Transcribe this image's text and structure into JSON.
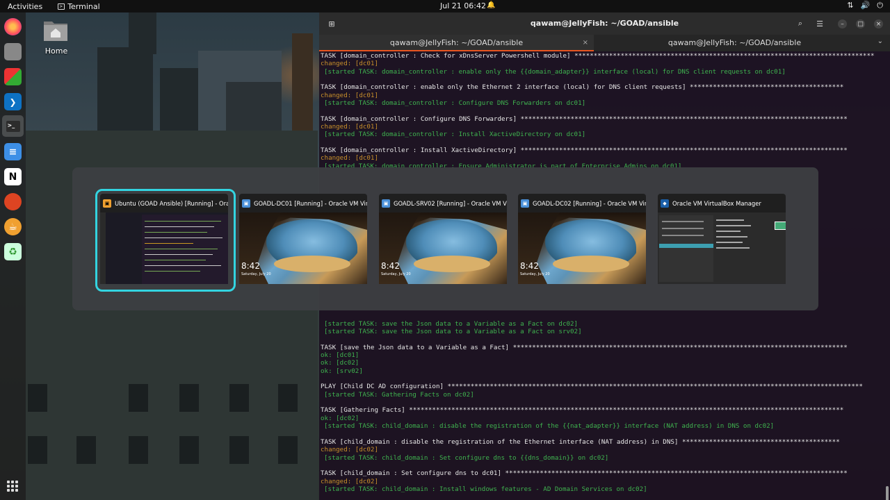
{
  "topbar": {
    "activities": "Activities",
    "app_name": "Terminal",
    "clock": "Jul 21  06:42"
  },
  "desktop": {
    "home_label": "Home"
  },
  "dock": {
    "items": [
      {
        "name": "firefox-icon"
      },
      {
        "name": "files-icon"
      },
      {
        "name": "virtualbox-icon"
      },
      {
        "name": "vscode-icon"
      },
      {
        "name": "terminal-icon"
      },
      {
        "name": "text-editor-icon"
      },
      {
        "name": "notion-icon"
      },
      {
        "name": "app-icon"
      },
      {
        "name": "java-icon"
      },
      {
        "name": "trash-icon"
      }
    ]
  },
  "terminal": {
    "title": "qawam@JellyFish: ~/GOAD/ansible",
    "tabs": [
      {
        "label": "qawam@JellyFish: ~/GOAD/ansible",
        "active": true
      },
      {
        "label": "qawam@JellyFish: ~/GOAD/ansible",
        "active": false
      }
    ],
    "accent_color": "#e95420",
    "lines": [
      {
        "type": "task",
        "text": "TASK [domain_controller : Check for xDnsServer Powershell module] ******************************************************************************"
      },
      {
        "type": "changed",
        "text": "changed: [dc01]"
      },
      {
        "type": "started",
        "text": "[started TASK: domain_controller : enable only the {{domain_adapter}} interface (local) for DNS client requests on dc01]"
      },
      {
        "type": "blank",
        "text": ""
      },
      {
        "type": "task",
        "text": "TASK [domain_controller : enable only the Ethernet 2 interface (local) for DNS client requests] ****************************************"
      },
      {
        "type": "changed",
        "text": "changed: [dc01]"
      },
      {
        "type": "started",
        "text": "[started TASK: domain_controller : Configure DNS Forwarders on dc01]"
      },
      {
        "type": "blank",
        "text": ""
      },
      {
        "type": "task",
        "text": "TASK [domain_controller : Configure DNS Forwarders] *************************************************************************************"
      },
      {
        "type": "changed",
        "text": "changed: [dc01]"
      },
      {
        "type": "started",
        "text": "[started TASK: domain_controller : Install XactiveDirectory on dc01]"
      },
      {
        "type": "blank",
        "text": ""
      },
      {
        "type": "task",
        "text": "TASK [domain_controller : Install XactiveDirectory] *************************************************************************************"
      },
      {
        "type": "changed",
        "text": "changed: [dc01]"
      },
      {
        "type": "started",
        "text": "[started TASK: domain_controller : Ensure Administrator is part of Enterprise Admins on dc01]"
      },
      {
        "type": "blank",
        "text": ""
      },
      {
        "type": "blank",
        "text": ""
      },
      {
        "type": "blank",
        "text": ""
      },
      {
        "type": "blank",
        "text": ""
      },
      {
        "type": "blank",
        "text": ""
      },
      {
        "type": "blank",
        "text": ""
      },
      {
        "type": "blank",
        "text": ""
      },
      {
        "type": "blank",
        "text": ""
      },
      {
        "type": "blank",
        "text": ""
      },
      {
        "type": "blank",
        "text": ""
      },
      {
        "type": "blank",
        "text": ""
      },
      {
        "type": "blank",
        "text": ""
      },
      {
        "type": "blank",
        "text": ""
      },
      {
        "type": "blank",
        "text": ""
      },
      {
        "type": "blank",
        "text": ""
      },
      {
        "type": "blank",
        "text": ""
      },
      {
        "type": "blank",
        "text": ""
      },
      {
        "type": "blank",
        "text": ""
      },
      {
        "type": "blank",
        "text": ""
      },
      {
        "type": "started",
        "text": "[started TASK: save the Json data to a Variable as a Fact on dc02]"
      },
      {
        "type": "started",
        "text": "[started TASK: save the Json data to a Variable as a Fact on srv02]"
      },
      {
        "type": "blank",
        "text": ""
      },
      {
        "type": "task",
        "text": "TASK [save the Json data to a Variable as a Fact] ***************************************************************************************"
      },
      {
        "type": "ok",
        "text": "ok: [dc01]"
      },
      {
        "type": "ok",
        "text": "ok: [dc02]"
      },
      {
        "type": "ok",
        "text": "ok: [srv02]"
      },
      {
        "type": "blank",
        "text": ""
      },
      {
        "type": "task",
        "text": "PLAY [Child DC AD configuration] ************************************************************************************************************"
      },
      {
        "type": "started",
        "text": "[started TASK: Gathering Facts on dc02]"
      },
      {
        "type": "blank",
        "text": ""
      },
      {
        "type": "task",
        "text": "TASK [Gathering Facts] *****************************************************************************************************************"
      },
      {
        "type": "ok",
        "text": "ok: [dc02]"
      },
      {
        "type": "started",
        "text": "[started TASK: child_domain : disable the registration of the {{nat_adapter}} interface (NAT address) in DNS on dc02]"
      },
      {
        "type": "blank",
        "text": ""
      },
      {
        "type": "task",
        "text": "TASK [child_domain : disable the registration of the Ethernet interface (NAT address) in DNS] *****************************************"
      },
      {
        "type": "changed",
        "text": "changed: [dc02]"
      },
      {
        "type": "started",
        "text": "[started TASK: child_domain : Set configure dns to {{dns_domain}} on dc02]"
      },
      {
        "type": "blank",
        "text": ""
      },
      {
        "type": "task",
        "text": "TASK [child_domain : Set configure dns to dc01] *****************************************************************************************"
      },
      {
        "type": "changed",
        "text": "changed: [dc02]"
      },
      {
        "type": "started",
        "text": "[started TASK: child_domain : Install windows features - AD Domain Services on dc02]"
      }
    ]
  },
  "switcher": {
    "selected_color": "#33d4e0",
    "windows": [
      {
        "title": "Ubuntu (GOAD Ansible) [Running] - Ora...",
        "kind": "terminal",
        "selected": true
      },
      {
        "title": "GOADL-DC01 [Running] - Oracle VM Virt...",
        "kind": "lockscreen",
        "time": "8:42",
        "date": "Saturday, July 20",
        "selected": false
      },
      {
        "title": "GOADL-SRV02 [Running] - Oracle VM Vi...",
        "kind": "lockscreen",
        "time": "8:42",
        "date": "Saturday, July 20",
        "selected": false
      },
      {
        "title": "GOADL-DC02 [Running] - Oracle VM Virt...",
        "kind": "lockscreen",
        "time": "8:42",
        "date": "Saturday, July 20",
        "selected": false
      },
      {
        "title": "Oracle VM VirtualBox Manager",
        "kind": "manager",
        "selected": false
      }
    ]
  }
}
